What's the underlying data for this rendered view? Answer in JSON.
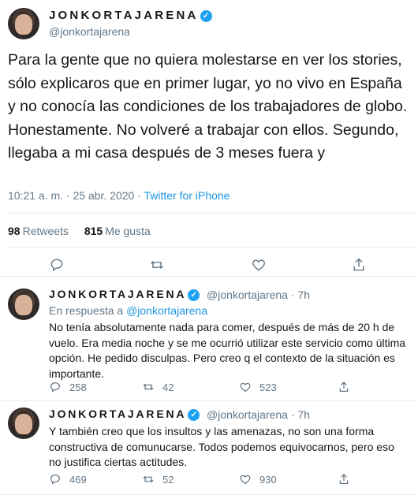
{
  "main_tweet": {
    "display_name": "JONKORTAJARENA",
    "handle": "@jonkortajarena",
    "text": "Para la gente que no quiera molestarse en ver los stories, sólo explicaros que en primer lugar, yo no vivo en España y no conocía las condiciones de los trabajadores de globo. Honestamente. No volveré a trabajar con ellos. Segundo, llegaba a mi casa después de 3 meses fuera y",
    "time_date": "10:21 a. m. · 25 abr. 2020 ·",
    "source": "Twitter for iPhone",
    "retweets_count": "98",
    "retweets_label": "Retweets",
    "likes_count": "815",
    "likes_label": "Me gusta",
    "actions": [
      "reply-icon",
      "retweet-icon",
      "like-icon",
      "share-icon"
    ]
  },
  "replies": [
    {
      "display_name": "JONKORTAJARENA",
      "handle": "@jonkortajarena",
      "time": "· 7h",
      "reply_prefix": "En respuesta a",
      "reply_to": "@jonkortajarena",
      "text": "No tenía absolutamente nada para comer, después de más de 20 h de vuelo. Era media noche y se me ocurrió utilizar este servicio como última opción. He pedido disculpas. Pero creo q el contexto de la situación es importante.",
      "replies": "258",
      "retweets": "42",
      "likes": "523"
    },
    {
      "display_name": "JONKORTAJARENA",
      "handle": "@jonkortajarena",
      "time": "· 7h",
      "text": "Y también creo que los insultos y las amenazas, no son una forma constructiva de comunucarse. Todos podemos equivocarnos, pero eso no justifica ciertas actitudes.",
      "replies": "469",
      "retweets": "52",
      "likes": "930"
    }
  ],
  "colors": {
    "text": "#14171a",
    "secondary": "#657786",
    "link": "#1b95e0",
    "verified": "#1da1f2",
    "divider": "#e6ecf0"
  }
}
